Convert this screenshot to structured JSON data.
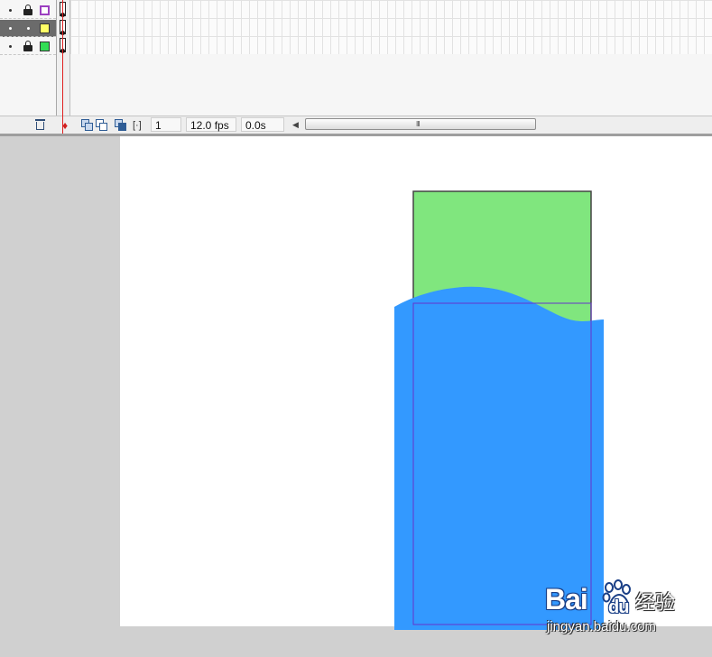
{
  "timeline": {
    "layers": [
      {
        "name": "",
        "selected": false,
        "locked": true,
        "color": "#9b3fc0",
        "swatch": "outline"
      },
      {
        "name": "",
        "selected": true,
        "locked": false,
        "color": "#ffff66",
        "swatch": "filled"
      },
      {
        "name": "",
        "selected": false,
        "locked": true,
        "color": "#33dd55",
        "swatch": "filled"
      }
    ],
    "status": {
      "current_frame": "1",
      "frame_rate": "12.0 fps",
      "elapsed_time": "0.0s",
      "scroll_grip": "III"
    }
  },
  "stage": {
    "background": "#ffffff",
    "shapes": {
      "rectangle_fill": "#80e67e",
      "rectangle_stroke": "#444444",
      "wave_fill": "#3399ff",
      "mask_outline": "#6633cc"
    }
  },
  "watermark": {
    "logo_text": "Bai",
    "logo_text_2": "du",
    "chinese_text": "经验",
    "url": "jingyan.baidu.com"
  }
}
